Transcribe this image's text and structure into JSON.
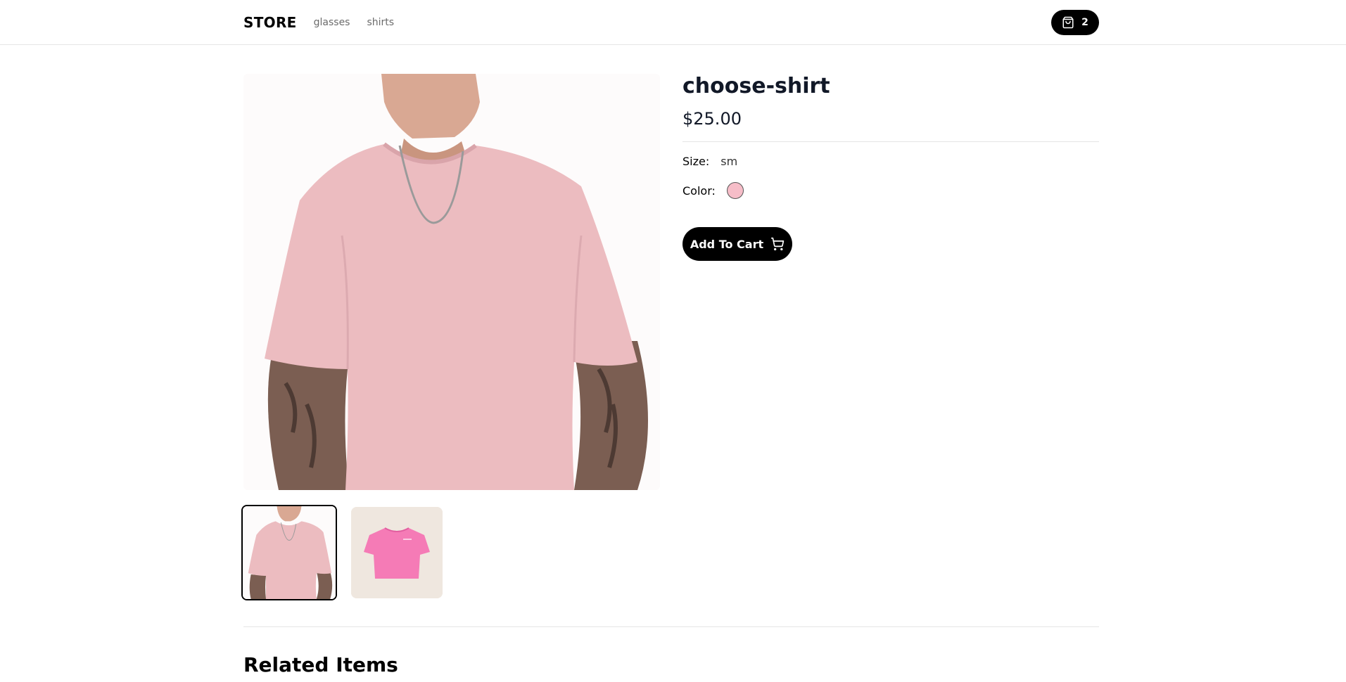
{
  "nav": {
    "brand": "STORE",
    "links": [
      "glasses",
      "shirts"
    ],
    "cart_count": "2"
  },
  "product": {
    "title": "choose-shirt",
    "price": "$25.00",
    "size_label": "Size:",
    "size_value": "sm",
    "color_label": "Color:",
    "color_hex": "#f6bdc8",
    "add_to_cart": "Add To Cart"
  },
  "related": {
    "heading": "Related Items"
  },
  "icons": {
    "cart_pill": "shopping-bag-icon",
    "add_button": "shopping-cart-icon"
  }
}
